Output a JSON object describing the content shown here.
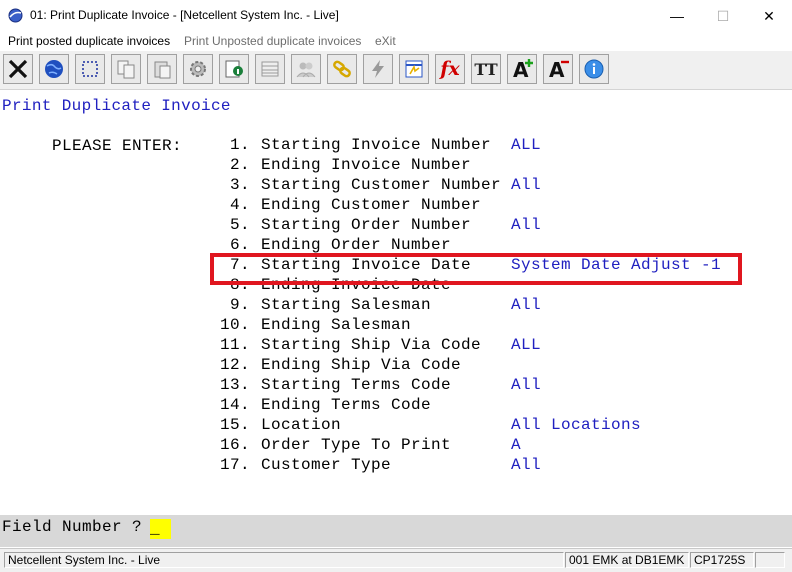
{
  "window": {
    "title": "01: Print Duplicate Invoice - [Netcellent System Inc. - Live]",
    "minimize_glyph": "—",
    "maximize_glyph": "☐",
    "close_glyph": "✕"
  },
  "menu": {
    "items": [
      {
        "label": "Print posted duplicate invoices",
        "enabled": true
      },
      {
        "label": "Print Unposted duplicate invoices",
        "enabled": false
      },
      {
        "label": "eXit",
        "enabled": false
      }
    ]
  },
  "toolbar": {
    "buttons": [
      {
        "icon": "close-x-icon"
      },
      {
        "icon": "globe-icon"
      },
      {
        "icon": "select-rectangle-icon"
      },
      {
        "icon": "copy-icon"
      },
      {
        "icon": "paste-icon"
      },
      {
        "icon": "settings-gear-icon"
      },
      {
        "icon": "info-document-icon"
      },
      {
        "icon": "list-grid-icon"
      },
      {
        "icon": "users-icon"
      },
      {
        "icon": "link-chain-icon"
      },
      {
        "icon": "lightning-icon"
      },
      {
        "icon": "spreadsheet-icon"
      },
      {
        "icon": "function-fx-icon"
      },
      {
        "icon": "font-size-icon"
      },
      {
        "icon": "font-increase-icon"
      },
      {
        "icon": "font-decrease-icon"
      },
      {
        "icon": "help-icon"
      }
    ],
    "fx_text": "fx",
    "tt_text": "TT",
    "a_text": "A"
  },
  "screen": {
    "title": "Print Duplicate Invoice",
    "prompt_label": "PLEASE ENTER:",
    "fields": [
      {
        "num": "1.",
        "label": "Starting Invoice Number",
        "value": "ALL"
      },
      {
        "num": "2.",
        "label": "Ending Invoice Number",
        "value": ""
      },
      {
        "num": "3.",
        "label": "Starting Customer Number",
        "value": "All"
      },
      {
        "num": "4.",
        "label": "Ending Customer Number",
        "value": ""
      },
      {
        "num": "5.",
        "label": "Starting Order Number",
        "value": "All"
      },
      {
        "num": "6.",
        "label": "Ending Order Number",
        "value": ""
      },
      {
        "num": "7.",
        "label": "Starting Invoice Date",
        "value": "System Date Adjust -1",
        "highlighted": true
      },
      {
        "num": "8.",
        "label": "Ending Invoice Date",
        "value": ""
      },
      {
        "num": "9.",
        "label": "Starting Salesman",
        "value": "All"
      },
      {
        "num": "10.",
        "label": "Ending Salesman",
        "value": ""
      },
      {
        "num": "11.",
        "label": "Starting Ship Via Code",
        "value": "ALL"
      },
      {
        "num": "12.",
        "label": "Ending Ship Via Code",
        "value": ""
      },
      {
        "num": "13.",
        "label": "Starting Terms Code",
        "value": "All"
      },
      {
        "num": "14.",
        "label": "Ending Terms Code",
        "value": ""
      },
      {
        "num": "15.",
        "label": "Location",
        "value": "All Locations"
      },
      {
        "num": "16.",
        "label": "Order Type To Print",
        "value": "A"
      },
      {
        "num": "17.",
        "label": "Customer Type",
        "value": "All"
      }
    ]
  },
  "prompt": {
    "label": "Field Number ?",
    "value": "_"
  },
  "status": {
    "company": "Netcellent System Inc. - Live",
    "user": "001 EMK at DB1EMK",
    "program": "CP1725S",
    "extra": ""
  },
  "colors": {
    "terminal_blue": "#2020c0",
    "highlight_red": "#e0161f",
    "input_yellow": "#ffff00"
  }
}
